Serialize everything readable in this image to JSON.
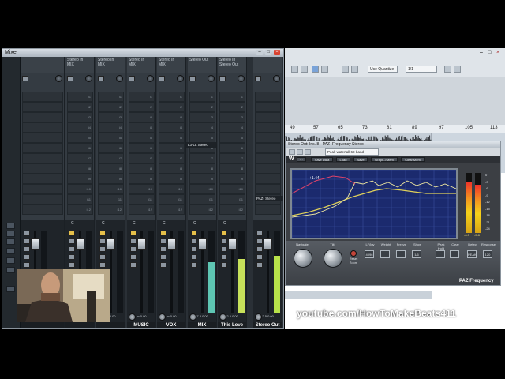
{
  "mixer": {
    "title": "Mixer",
    "channels": [
      {
        "route1": "",
        "route2": "",
        "letter": "",
        "val": "",
        "name": "",
        "meter": 0
      },
      {
        "route1": "Stereo In",
        "route2": "MIX",
        "letter": "C",
        "val": "-∞   0.00",
        "name": "",
        "meter": 0.0
      },
      {
        "route1": "Stereo In",
        "route2": "MIX",
        "letter": "C",
        "val": "-∞   0.00",
        "name": "",
        "meter": 0.0
      },
      {
        "route1": "Stereo In",
        "route2": "MIX",
        "letter": "C",
        "val": "-∞   0.00",
        "name": "MUSIC",
        "meter": 0.0
      },
      {
        "route1": "Stereo In",
        "route2": "MIX",
        "letter": "C",
        "val": "-∞   0.00",
        "name": "VOX",
        "meter": 0.0
      },
      {
        "route1": "Stereo Out",
        "route2": "",
        "letter": "C",
        "val": "-7.8   0.00",
        "name": "MIX",
        "meter": 0.62
      },
      {
        "route1": "Stereo In",
        "route2": "Stereo Out",
        "letter": "C",
        "val": "-2.5   0.00",
        "name": "This Love",
        "meter": 0.66
      },
      {
        "route1": "",
        "route2": "",
        "letter": "",
        "val": "-2.5   0.00",
        "name": "Stereo Out",
        "meter": 0.7
      }
    ],
    "insert_label": "L3-LL Stereo",
    "paz_label": "PAZ- Stereo"
  },
  "project": {
    "quantize": "Use Quantize",
    "quantize_value": "1/1",
    "ruler": [
      "49",
      "57",
      "65",
      "73",
      "81",
      "89",
      "97",
      "105",
      "113"
    ]
  },
  "paz": {
    "title": "Stereo Out: Ins. 8 - PAZ- Frequency Stereo",
    "preset": "Peak waterfall 68-band",
    "buttons": [
      "Save Data",
      "Load",
      "Save",
      "Graph->Mem",
      "Clear Mem"
    ],
    "readout": "+1.44",
    "knob_labels": [
      "Navigate",
      "Tilt"
    ],
    "reset": "Reset Zoom",
    "group_labels": [
      "LF/Inv",
      "Weight",
      "Freeze",
      "Show",
      "Peak Hold",
      "Clear",
      "Detect",
      "Response"
    ],
    "btn_texts": [
      "4096",
      "",
      "",
      "1/6",
      "",
      "",
      "PEAK",
      "120"
    ],
    "brand": "PAZ Frequency",
    "left_meter": 0.85,
    "right_meter": 0.8,
    "left_peak": "-6.3",
    "right_peak": "-5.8",
    "db_scale": [
      "0",
      "-3",
      "-6",
      "-9",
      "-12",
      "-15",
      "-18",
      "-21",
      "-24"
    ]
  },
  "overlay": {
    "watermark": "youtube.com/HowToMakeBeats411"
  }
}
